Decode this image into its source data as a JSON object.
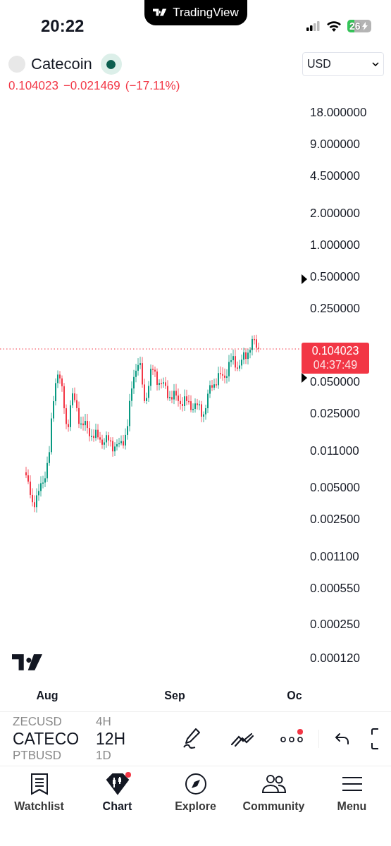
{
  "status_bar": {
    "time": "20:22",
    "banner": "TradingView",
    "battery": "26"
  },
  "symbol": {
    "name": "Catecoin",
    "currency": "USD",
    "price": "0.104023",
    "change": "−0.021469",
    "change_percent": "(−17.11%)"
  },
  "chart": {
    "price_axis": [
      "18.000000",
      "9.000000",
      "4.500000",
      "2.000000",
      "1.000000",
      "0.500000",
      "0.250000",
      "0.050000",
      "0.025000",
      "0.011000",
      "0.005000",
      "0.002500",
      "0.001100",
      "0.000550",
      "0.000250",
      "0.000120"
    ],
    "last_price": "0.104023",
    "countdown": "04:37:49",
    "time_axis": [
      "Aug",
      "Sep",
      "Oc"
    ]
  },
  "toolbar": {
    "symbols": [
      {
        "label": "ZECUSD",
        "selected": false
      },
      {
        "label": "CATECO",
        "selected": true
      },
      {
        "label": "PTBUSD",
        "selected": false
      }
    ],
    "intervals": [
      {
        "label": "4H",
        "selected": false
      },
      {
        "label": "12H",
        "selected": true
      },
      {
        "label": "1D",
        "selected": false
      }
    ],
    "more_badge": true
  },
  "nav": [
    {
      "label": "Watchlist",
      "selected": false,
      "badge": false
    },
    {
      "label": "Chart",
      "selected": true,
      "badge": true
    },
    {
      "label": "Explore",
      "selected": false,
      "badge": false
    },
    {
      "label": "Community",
      "selected": false,
      "badge": false
    },
    {
      "label": "Menu",
      "selected": false,
      "badge": false
    }
  ]
}
